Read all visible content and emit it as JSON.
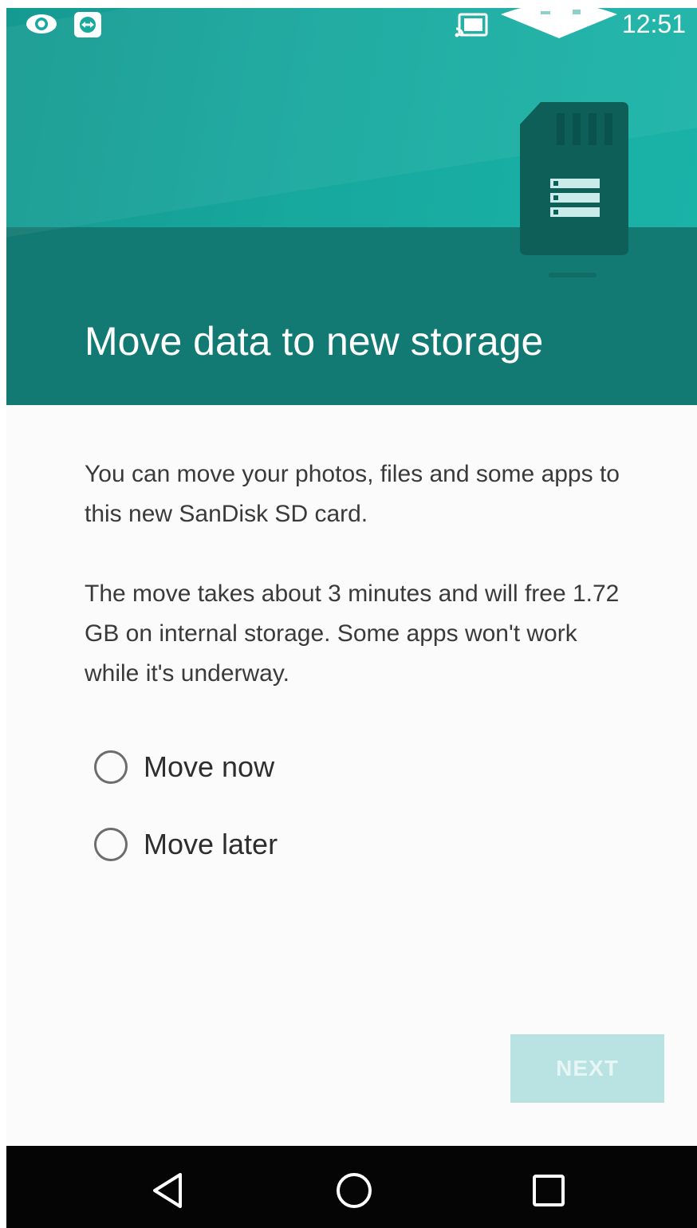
{
  "status_bar": {
    "time": "12:51",
    "icons": [
      "eye-icon",
      "teamviewer-icon",
      "cast-icon",
      "wifi-icon",
      "signal-icon"
    ]
  },
  "header": {
    "title": "Move data to new storage",
    "illustration": "sd-card-icon"
  },
  "content": {
    "paragraph_1": "You can move your photos, files and some apps to this new SanDisk SD card.",
    "paragraph_2": "The move takes about 3 minutes and will free 1.72 GB on internal storage. Some apps won't work while it's underway."
  },
  "options": [
    {
      "label": "Move now",
      "selected": false
    },
    {
      "label": "Move later",
      "selected": false
    }
  ],
  "actions": {
    "next_label": "NEXT",
    "next_enabled": false
  },
  "navigation": {
    "buttons": [
      "back-icon",
      "home-icon",
      "recents-icon"
    ]
  },
  "colors": {
    "header_light": "#17a89e",
    "header_dark": "#127a72",
    "button_disabled": "#b9e3e2"
  }
}
